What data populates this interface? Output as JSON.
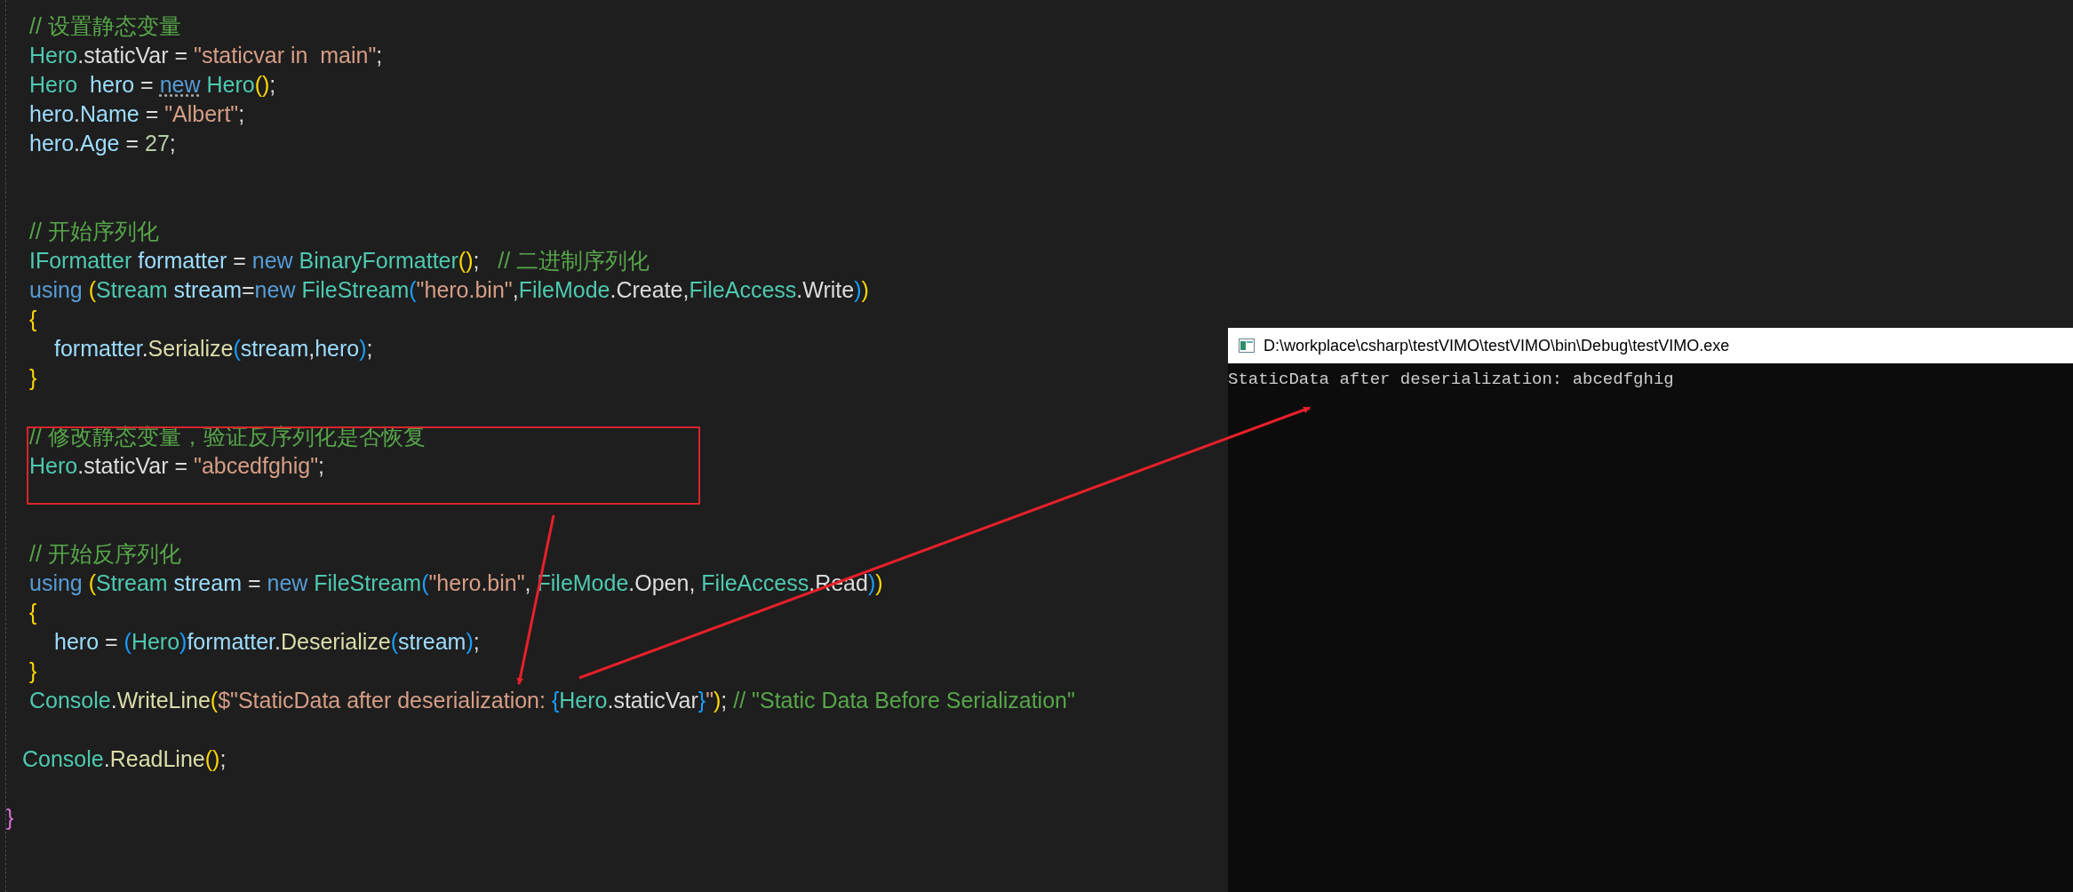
{
  "editor": {
    "lines": [
      {
        "kind": "statement",
        "tokens": [
          {
            "text": "// 设置静态变量",
            "kind": "comment"
          }
        ]
      },
      {
        "kind": "statement",
        "tokens": [
          {
            "text": "Hero",
            "kind": "type"
          },
          {
            "text": ".staticVar = ",
            "kind": "plain"
          },
          {
            "text": "\"staticvar in  main\"",
            "kind": "string"
          },
          {
            "text": ";",
            "kind": "plain"
          }
        ]
      },
      {
        "kind": "statement",
        "tokens": [
          {
            "text": "Hero  ",
            "kind": "type"
          },
          {
            "text": "hero",
            "kind": "variable"
          },
          {
            "text": " = ",
            "kind": "plain"
          },
          {
            "text": "new",
            "kind": "keyword",
            "hint": true
          },
          {
            "text": " Hero",
            "kind": "type"
          },
          {
            "text": "()",
            "kind": "bracket1"
          },
          {
            "text": ";",
            "kind": "plain"
          }
        ]
      },
      {
        "kind": "statement",
        "tokens": [
          {
            "text": "hero",
            "kind": "variable"
          },
          {
            "text": ".",
            "kind": "plain"
          },
          {
            "text": "Name",
            "kind": "variable"
          },
          {
            "text": " = ",
            "kind": "plain"
          },
          {
            "text": "\"Albert\"",
            "kind": "string"
          },
          {
            "text": ";",
            "kind": "plain"
          }
        ]
      },
      {
        "kind": "statement",
        "tokens": [
          {
            "text": "hero",
            "kind": "variable"
          },
          {
            "text": ".",
            "kind": "plain"
          },
          {
            "text": "Age",
            "kind": "variable"
          },
          {
            "text": " = ",
            "kind": "plain"
          },
          {
            "text": "27",
            "kind": "number"
          },
          {
            "text": ";",
            "kind": "plain"
          }
        ]
      },
      {
        "kind": "blank"
      },
      {
        "kind": "blank"
      },
      {
        "kind": "statement",
        "tokens": [
          {
            "text": "// 开始序列化",
            "kind": "comment"
          }
        ]
      },
      {
        "kind": "statement",
        "tokens": [
          {
            "text": "IFormatter ",
            "kind": "type"
          },
          {
            "text": "formatter",
            "kind": "variable"
          },
          {
            "text": " = ",
            "kind": "plain"
          },
          {
            "text": "new ",
            "kind": "keyword"
          },
          {
            "text": "BinaryFormatter",
            "kind": "type"
          },
          {
            "text": "()",
            "kind": "bracket1"
          },
          {
            "text": ";   ",
            "kind": "plain"
          },
          {
            "text": "// 二进制序列化",
            "kind": "comment"
          }
        ]
      },
      {
        "kind": "statement",
        "tokens": [
          {
            "text": "using ",
            "kind": "keyword"
          },
          {
            "text": "(",
            "kind": "bracket1"
          },
          {
            "text": "Stream ",
            "kind": "type"
          },
          {
            "text": "stream",
            "kind": "variable"
          },
          {
            "text": "=",
            "kind": "plain"
          },
          {
            "text": "new ",
            "kind": "keyword"
          },
          {
            "text": "FileStream",
            "kind": "type"
          },
          {
            "text": "(",
            "kind": "bracket2"
          },
          {
            "text": "\"hero.bin\"",
            "kind": "string"
          },
          {
            "text": ",",
            "kind": "plain"
          },
          {
            "text": "FileMode",
            "kind": "type"
          },
          {
            "text": ".Create,",
            "kind": "plain"
          },
          {
            "text": "FileAccess",
            "kind": "type"
          },
          {
            "text": ".Write",
            "kind": "plain"
          },
          {
            "text": ")",
            "kind": "bracket2"
          },
          {
            "text": ")",
            "kind": "bracket1"
          }
        ]
      },
      {
        "kind": "statement",
        "tokens": [
          {
            "text": "{",
            "kind": "bracket1"
          }
        ]
      },
      {
        "kind": "nested",
        "tokens": [
          {
            "text": "formatter",
            "kind": "variable"
          },
          {
            "text": ".",
            "kind": "plain"
          },
          {
            "text": "Serialize",
            "kind": "method"
          },
          {
            "text": "(",
            "kind": "bracket2"
          },
          {
            "text": "stream",
            "kind": "variable"
          },
          {
            "text": ",",
            "kind": "plain"
          },
          {
            "text": "hero",
            "kind": "variable"
          },
          {
            "text": ")",
            "kind": "bracket2"
          },
          {
            "text": ";",
            "kind": "plain"
          }
        ]
      },
      {
        "kind": "statement",
        "tokens": [
          {
            "text": "}",
            "kind": "bracket1"
          }
        ]
      },
      {
        "kind": "blank"
      },
      {
        "kind": "statement",
        "tokens": [
          {
            "text": "// 修改静态变量，验证反序列化是否恢复",
            "kind": "comment"
          }
        ]
      },
      {
        "kind": "statement",
        "tokens": [
          {
            "text": "Hero",
            "kind": "type"
          },
          {
            "text": ".staticVar = ",
            "kind": "plain"
          },
          {
            "text": "\"abcedfghig\"",
            "kind": "string"
          },
          {
            "text": ";",
            "kind": "plain"
          }
        ]
      },
      {
        "kind": "blank"
      },
      {
        "kind": "blank"
      },
      {
        "kind": "statement",
        "tokens": [
          {
            "text": "// 开始反序列化",
            "kind": "comment"
          }
        ]
      },
      {
        "kind": "statement",
        "tokens": [
          {
            "text": "using ",
            "kind": "keyword"
          },
          {
            "text": "(",
            "kind": "bracket1"
          },
          {
            "text": "Stream ",
            "kind": "type"
          },
          {
            "text": "stream",
            "kind": "variable"
          },
          {
            "text": " = ",
            "kind": "plain"
          },
          {
            "text": "new ",
            "kind": "keyword"
          },
          {
            "text": "FileStream",
            "kind": "type"
          },
          {
            "text": "(",
            "kind": "bracket2"
          },
          {
            "text": "\"hero.bin\"",
            "kind": "string"
          },
          {
            "text": ", ",
            "kind": "plain"
          },
          {
            "text": "FileMode",
            "kind": "type"
          },
          {
            "text": ".Open, ",
            "kind": "plain"
          },
          {
            "text": "FileAccess",
            "kind": "type"
          },
          {
            "text": ".Read",
            "kind": "plain"
          },
          {
            "text": ")",
            "kind": "bracket2"
          },
          {
            "text": ")",
            "kind": "bracket1"
          }
        ]
      },
      {
        "kind": "statement",
        "tokens": [
          {
            "text": "{",
            "kind": "bracket1"
          }
        ]
      },
      {
        "kind": "nested",
        "tokens": [
          {
            "text": "hero",
            "kind": "variable"
          },
          {
            "text": " = ",
            "kind": "plain"
          },
          {
            "text": "(",
            "kind": "bracket2"
          },
          {
            "text": "Hero",
            "kind": "type"
          },
          {
            "text": ")",
            "kind": "bracket2"
          },
          {
            "text": "formatter",
            "kind": "variable"
          },
          {
            "text": ".",
            "kind": "plain"
          },
          {
            "text": "Deserialize",
            "kind": "method"
          },
          {
            "text": "(",
            "kind": "bracket2"
          },
          {
            "text": "stream",
            "kind": "variable"
          },
          {
            "text": ")",
            "kind": "bracket2"
          },
          {
            "text": ";",
            "kind": "plain"
          }
        ]
      },
      {
        "kind": "statement",
        "tokens": [
          {
            "text": "}",
            "kind": "bracket1"
          }
        ]
      },
      {
        "kind": "statement",
        "tokens": [
          {
            "text": "Console",
            "kind": "type"
          },
          {
            "text": ".",
            "kind": "plain"
          },
          {
            "text": "WriteLine",
            "kind": "method"
          },
          {
            "text": "(",
            "kind": "bracket1"
          },
          {
            "text": "$\"StaticData after deserialization: ",
            "kind": "string"
          },
          {
            "text": "{",
            "kind": "bracket2"
          },
          {
            "text": "Hero",
            "kind": "type"
          },
          {
            "text": ".staticVar",
            "kind": "plain"
          },
          {
            "text": "}",
            "kind": "bracket2"
          },
          {
            "text": "\"",
            "kind": "string"
          },
          {
            "text": ")",
            "kind": "bracket1"
          },
          {
            "text": "; ",
            "kind": "plain"
          },
          {
            "text": "// \"Static Data Before Serialization\"",
            "kind": "comment"
          }
        ]
      },
      {
        "kind": "blank"
      },
      {
        "kind": "outer",
        "tokens": [
          {
            "text": "Console",
            "kind": "type"
          },
          {
            "text": ".",
            "kind": "plain"
          },
          {
            "text": "ReadLine",
            "kind": "method"
          },
          {
            "text": "()",
            "kind": "bracket1"
          },
          {
            "text": ";",
            "kind": "plain"
          }
        ]
      },
      {
        "kind": "blank"
      },
      {
        "kind": "edge",
        "tokens": [
          {
            "text": "}",
            "kind": "bracket3"
          }
        ]
      }
    ]
  },
  "console": {
    "title": "D:\\workplace\\csharp\\testVIMO\\testVIMO\\bin\\Debug\\testVIMO.exe",
    "output": [
      "StaticData after deserialization: abcedfghig"
    ]
  }
}
